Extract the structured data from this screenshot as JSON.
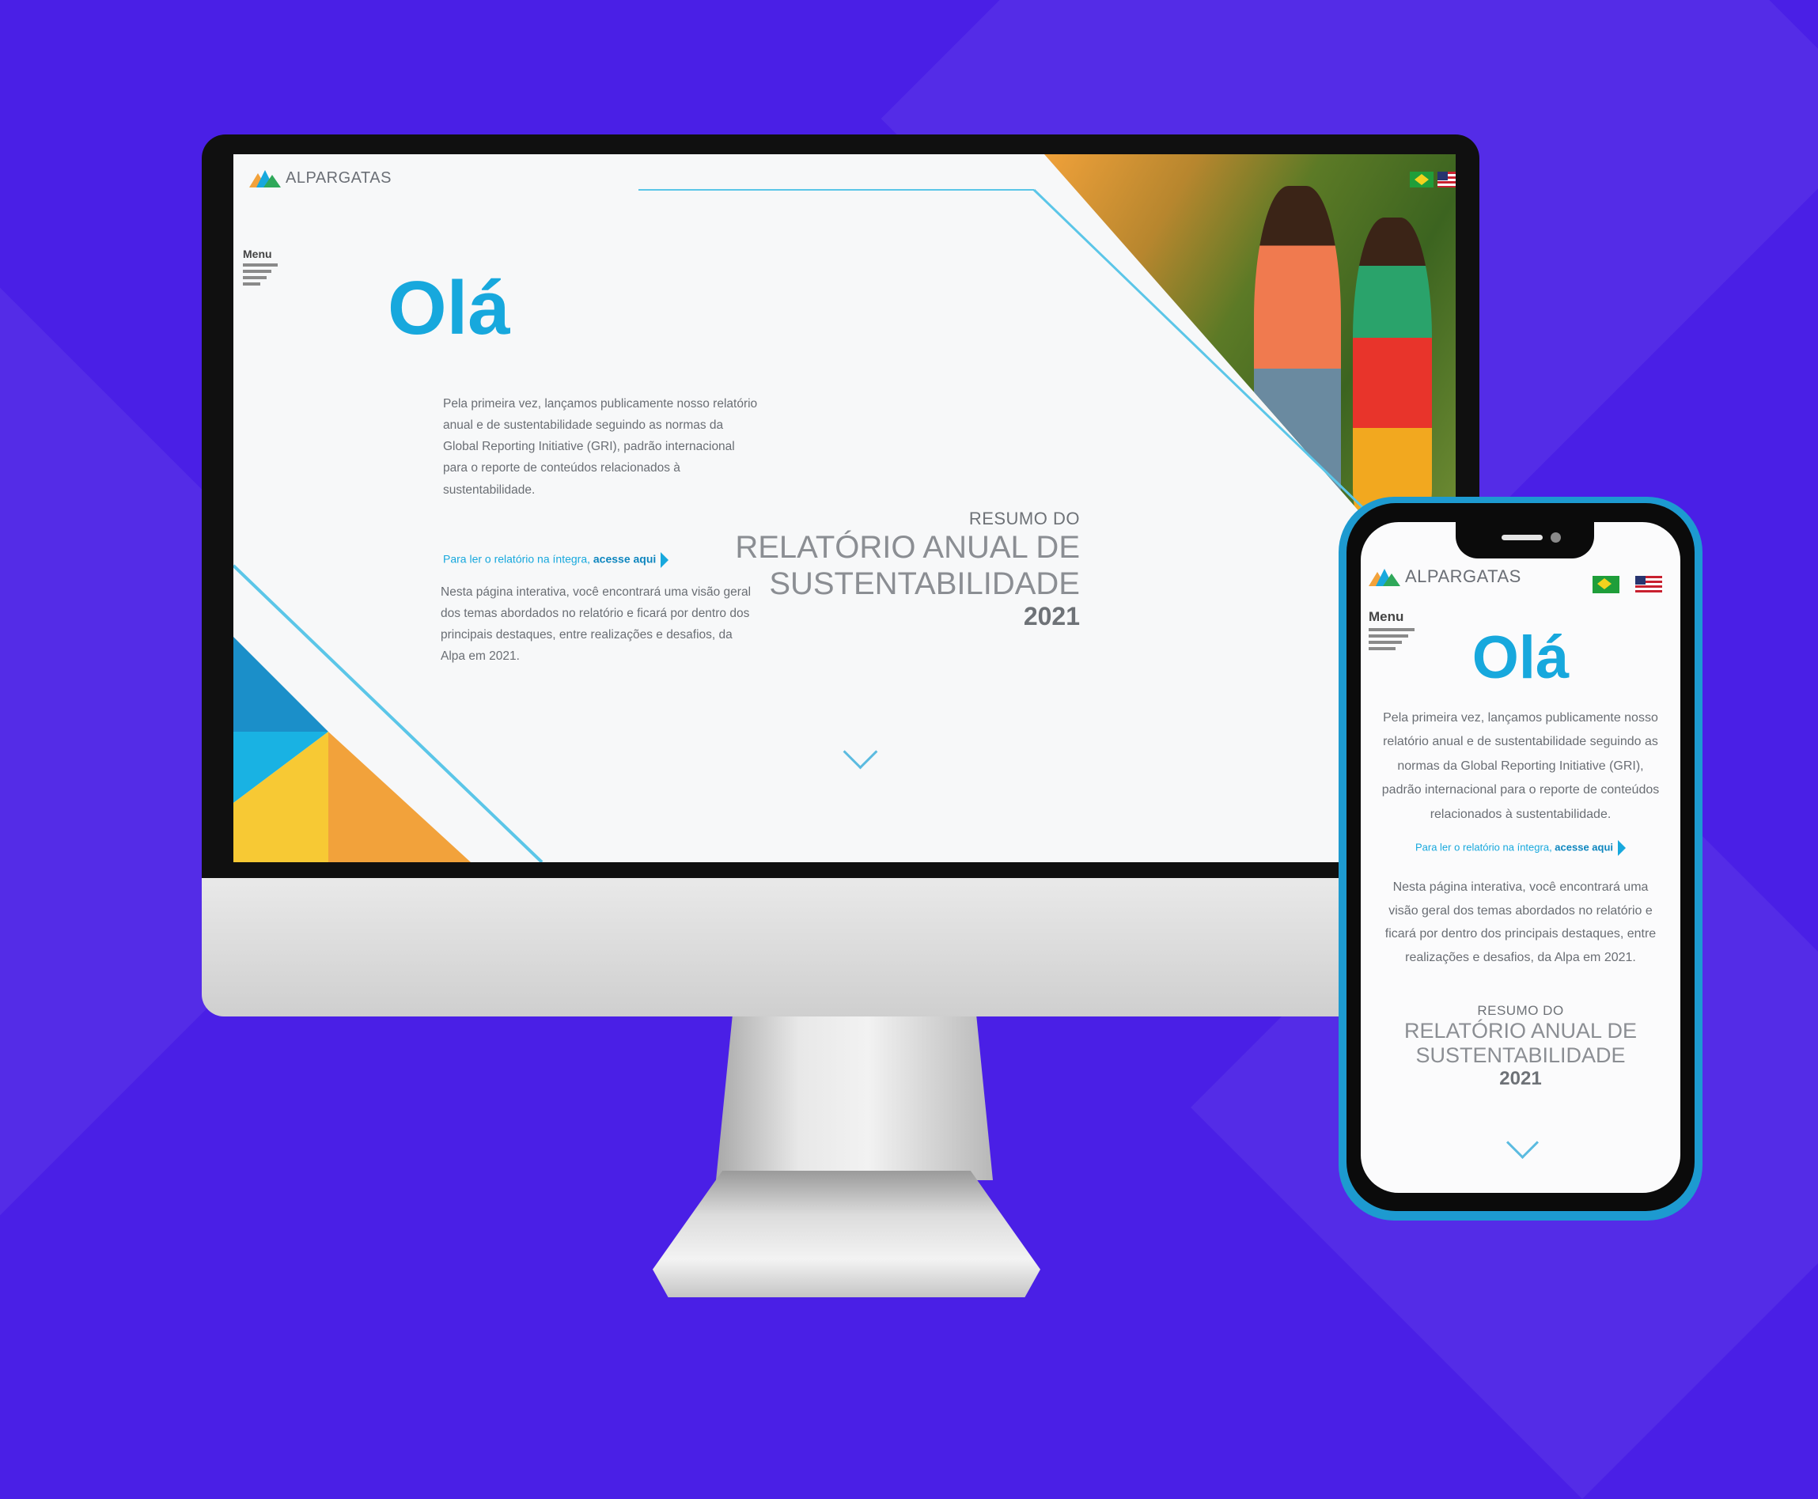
{
  "brand": {
    "name": "ALPARGATAS"
  },
  "menu": {
    "label": "Menu"
  },
  "hero": {
    "greeting": "Olá",
    "desktop_intro_lines": [
      "Pela primeira vez, lançamos publicamente nosso relatório",
      "anual e de sustentabilidade seguindo as normas da",
      "Global Reporting Initiative (GRI), padrão internacional",
      "para o reporte de conteúdos relacionados à",
      "sustentabilidade."
    ],
    "link_prefix": "Para ler o relatório na íntegra, ",
    "link_action": "acesse aqui",
    "desktop_detail_lines": [
      "Nesta página interativa, você encontrará uma visão geral",
      "dos temas abordados no relatório e ficará por dentro dos",
      "principais destaques, entre realizações e desafios, da",
      "Alpa em 2021."
    ],
    "mobile_intro_lines": [
      "Pela primeira vez, lançamos publicamente nosso",
      "relatório anual e de sustentabilidade seguindo as",
      "normas da Global Reporting Initiative (GRI),",
      "padrão internacional para o reporte de conteúdos",
      "relacionados à sustentabilidade."
    ],
    "mobile_detail_lines": [
      "Nesta página interativa, você encontrará uma",
      "visão geral dos temas abordados no relatório e",
      "ficará por dentro dos principais destaques, entre",
      "realizações e desafios, da Alpa em 2021."
    ]
  },
  "report": {
    "line1": "RESUMO DO",
    "line2": "RELATÓRIO ANUAL DE",
    "line3": "SUSTENTABILIDADE",
    "year": "2021"
  },
  "icons": {
    "flag_pt": "brazil-flag-icon",
    "flag_en": "usa-flag-icon",
    "scroll": "chevron-down-icon",
    "menu": "hamburger-icon"
  },
  "colors": {
    "background": "#4a1fe6",
    "accent_blue": "#17a8dd",
    "phone_frame": "#1d9ad0"
  }
}
